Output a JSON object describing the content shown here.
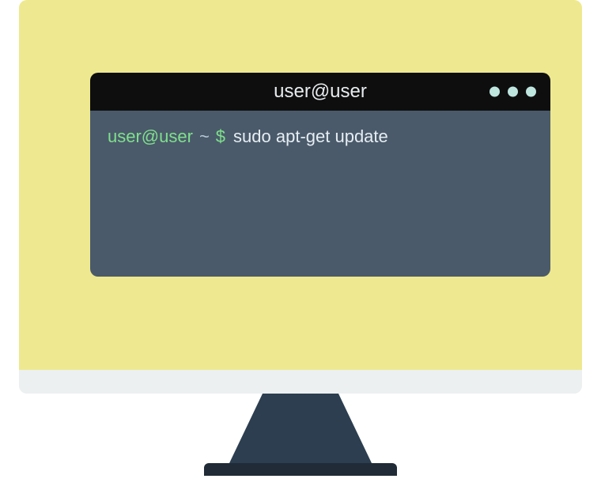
{
  "terminal": {
    "title": "user@user",
    "prompt": {
      "user": "user@user",
      "path": "~",
      "symbol": "$"
    },
    "command": "sudo apt-get update"
  }
}
